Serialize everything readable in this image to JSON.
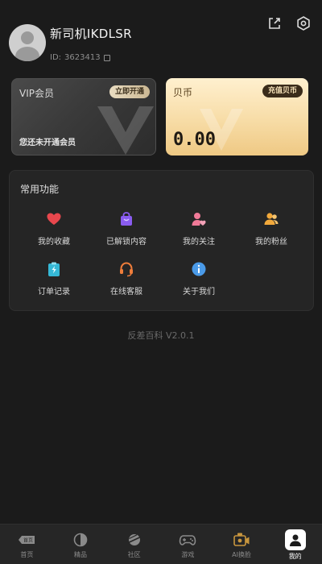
{
  "profile": {
    "username": "新司机IKDLSR",
    "uid_label": "ID:",
    "uid_value": "3623413"
  },
  "vip_card": {
    "title": "VIP会员",
    "button_label": "立即开通",
    "status_text": "您还未开通会员"
  },
  "coin_card": {
    "title": "贝币",
    "button_label": "充值贝币",
    "amount": "0.00"
  },
  "functions": {
    "title": "常用功能",
    "items": [
      {
        "label": "我的收藏",
        "icon": "heart-icon",
        "color": "#e8474d"
      },
      {
        "label": "已解锁内容",
        "icon": "shopping-bag-icon",
        "color": "#8a5cf0"
      },
      {
        "label": "我的关注",
        "icon": "user-heart-icon",
        "color": "#f07a98"
      },
      {
        "label": "我的粉丝",
        "icon": "users-icon",
        "color": "#f2a93b"
      },
      {
        "label": "订单记录",
        "icon": "order-icon",
        "color": "#35b8d6"
      },
      {
        "label": "在线客服",
        "icon": "headset-icon",
        "color": "#ef7d3b"
      },
      {
        "label": "关于我们",
        "icon": "info-icon",
        "color": "#4a9ae8"
      }
    ]
  },
  "version_text": "反差百科 V2.0.1",
  "bottom_nav": {
    "items": [
      {
        "label": "首页",
        "icon": "home-icon"
      },
      {
        "label": "精品",
        "icon": "half-circle-icon"
      },
      {
        "label": "社区",
        "icon": "planet-icon"
      },
      {
        "label": "游戏",
        "icon": "gamepad-icon"
      },
      {
        "label": "AI换脸",
        "icon": "ai-camera-icon"
      },
      {
        "label": "我的",
        "icon": "profile-icon"
      }
    ],
    "home_badge": "首页",
    "active_index": 5
  }
}
